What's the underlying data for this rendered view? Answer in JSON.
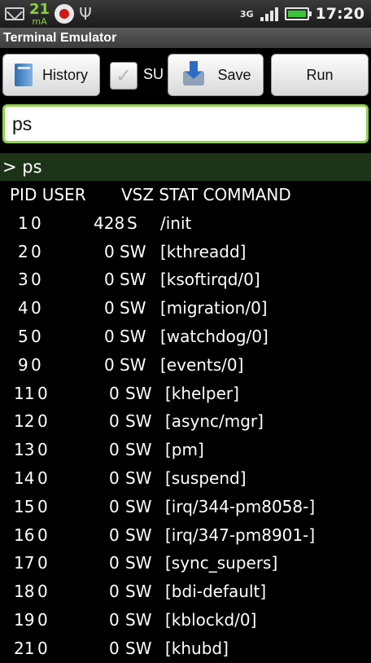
{
  "status_bar": {
    "charge_value": "21",
    "charge_unit": "mA",
    "network": "3G",
    "time": "17:20",
    "icons": [
      "mail-icon",
      "record-icon",
      "usb-icon",
      "signal-icon",
      "battery-icon"
    ],
    "battery_color": "#39c63a",
    "indicator_color": "#8bd23b"
  },
  "app": {
    "title": "Terminal Emulator"
  },
  "toolbar": {
    "history_label": "History",
    "su_label": "SU",
    "su_checked": false,
    "save_label": "Save",
    "run_label": "Run"
  },
  "command_input": {
    "value": "ps"
  },
  "prompt": {
    "text": "> ps"
  },
  "output": {
    "header_left": "PID USER",
    "header_right": "VSZ STAT COMMAND",
    "rows": [
      {
        "pid": "1",
        "user": "0",
        "vsz": "428",
        "stat": "S",
        "command": "/init"
      },
      {
        "pid": "2",
        "user": "0",
        "vsz": "0",
        "stat": "SW",
        "command": "[kthreadd]"
      },
      {
        "pid": "3",
        "user": "0",
        "vsz": "0",
        "stat": "SW",
        "command": "[ksoftirqd/0]"
      },
      {
        "pid": "4",
        "user": "0",
        "vsz": "0",
        "stat": "SW",
        "command": "[migration/0]"
      },
      {
        "pid": "5",
        "user": "0",
        "vsz": "0",
        "stat": "SW",
        "command": "[watchdog/0]"
      },
      {
        "pid": "9",
        "user": "0",
        "vsz": "0",
        "stat": "SW",
        "command": "[events/0]"
      },
      {
        "pid": "11",
        "user": "0",
        "vsz": "0",
        "stat": "SW",
        "command": "[khelper]"
      },
      {
        "pid": "12",
        "user": "0",
        "vsz": "0",
        "stat": "SW",
        "command": "[async/mgr]"
      },
      {
        "pid": "13",
        "user": "0",
        "vsz": "0",
        "stat": "SW",
        "command": "[pm]"
      },
      {
        "pid": "14",
        "user": "0",
        "vsz": "0",
        "stat": "SW",
        "command": "[suspend]"
      },
      {
        "pid": "15",
        "user": "0",
        "vsz": "0",
        "stat": "SW",
        "command": "[irq/344-pm8058-]"
      },
      {
        "pid": "16",
        "user": "0",
        "vsz": "0",
        "stat": "SW",
        "command": "[irq/347-pm8901-]"
      },
      {
        "pid": "17",
        "user": "0",
        "vsz": "0",
        "stat": "SW",
        "command": "[sync_supers]"
      },
      {
        "pid": "18",
        "user": "0",
        "vsz": "0",
        "stat": "SW",
        "command": "[bdi-default]"
      },
      {
        "pid": "19",
        "user": "0",
        "vsz": "0",
        "stat": "SW",
        "command": "[kblockd/0]"
      },
      {
        "pid": "21",
        "user": "0",
        "vsz": "0",
        "stat": "SW",
        "command": "[khubd]"
      }
    ]
  }
}
